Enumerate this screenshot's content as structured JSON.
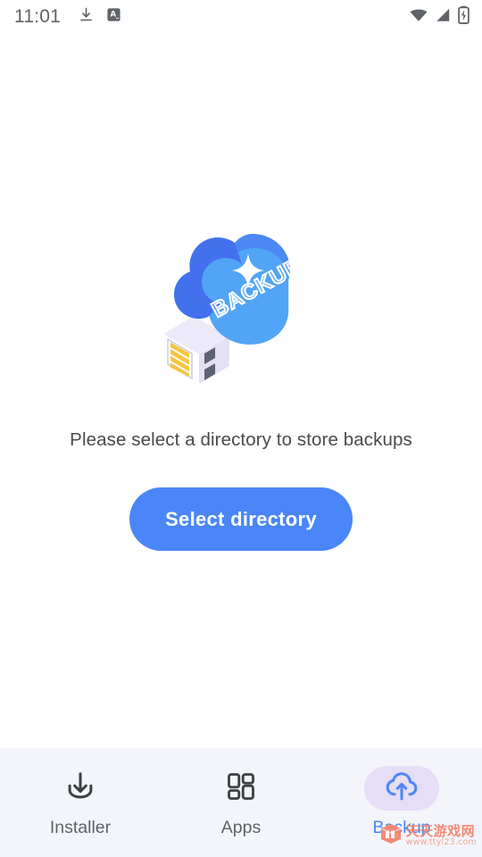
{
  "status_bar": {
    "time": "11:01",
    "left_icons": [
      {
        "name": "download-icon",
        "label": "download"
      },
      {
        "name": "screenshot-a-icon",
        "label": "A"
      }
    ],
    "right_icons": [
      {
        "name": "wifi-icon",
        "label": "wifi"
      },
      {
        "name": "cellular-signal-icon",
        "label": "signal"
      },
      {
        "name": "battery-charging-icon",
        "label": "battery charging"
      }
    ],
    "text_color": "#5f6368"
  },
  "main": {
    "illustration": {
      "name": "cloud-backup-usb-illustration",
      "label_on_cloud": "BACKUP",
      "colors": {
        "cloud_light": "#52a4f6",
        "cloud_dark": "#4371ee",
        "usb_body": "#ffffff",
        "usb_shade": "#e4e4f5",
        "usb_contacts": "#f5c542",
        "sparkle": "#ffffff"
      }
    },
    "prompt": "Please select a directory to store backups",
    "primary_button": {
      "label": "Select directory",
      "background": "#4a86f7",
      "text_color": "#ffffff"
    }
  },
  "bottom_nav": {
    "background": "#f3f5fb",
    "active_pill_color": "#e6ddf7",
    "active_color": "#4a86f7",
    "inactive_color": "#5f6368",
    "items": [
      {
        "label": "Installer",
        "icon": "download-tray-icon",
        "active": false
      },
      {
        "label": "Apps",
        "icon": "grid-apps-icon",
        "active": false
      },
      {
        "label": "Backup",
        "icon": "cloud-upload-icon",
        "active": true
      }
    ]
  },
  "watermark": {
    "title": "天天游戏网",
    "url": "www.ttyl23.com",
    "color": "#f4836a"
  }
}
